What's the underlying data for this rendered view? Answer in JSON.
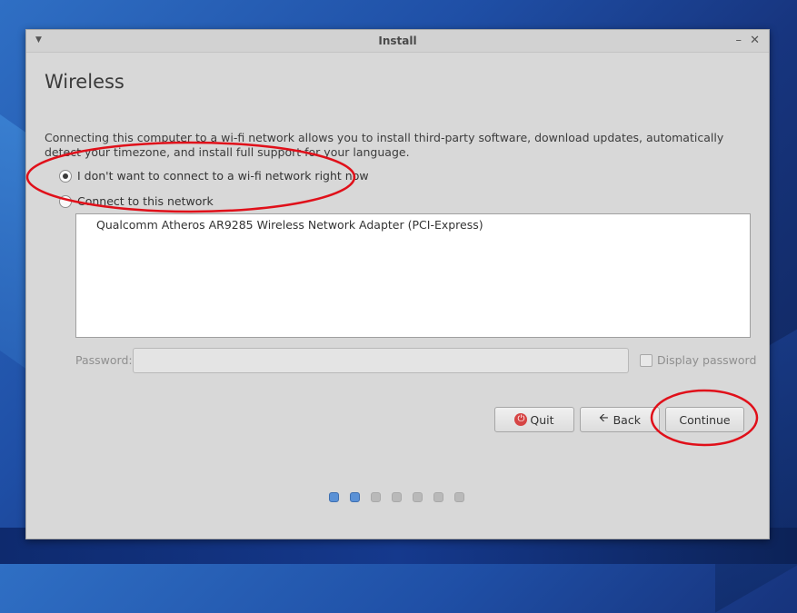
{
  "window": {
    "title": "Install"
  },
  "page": {
    "title": "Wireless",
    "description": "Connecting this computer to a wi-fi network allows you to install third-party software, download updates, automatically detect your timezone, and install full support for your language."
  },
  "options": {
    "no_wifi_label": "I don't want to connect to a wi-fi network right now",
    "no_wifi_selected": true,
    "connect_label": "Connect to this network",
    "connect_selected": false
  },
  "networks": [
    {
      "name": "Qualcomm Atheros AR9285 Wireless Network Adapter (PCI-Express)"
    }
  ],
  "password": {
    "label": "Password:",
    "value": "",
    "display_label": "Display password",
    "display_checked": false
  },
  "buttons": {
    "quit": "Quit",
    "back": "Back",
    "continue": "Continue"
  },
  "progress": {
    "total_steps": 7,
    "completed_steps": 2,
    "active_color": "#5a91d6",
    "inactive_color": "#b9b9b9"
  },
  "icons": {
    "menu": "chevron-down-icon",
    "minimize": "minimize-icon",
    "close": "close-icon",
    "quit": "power-icon",
    "back": "arrow-left-icon"
  },
  "annotation_color": "#e0101a"
}
